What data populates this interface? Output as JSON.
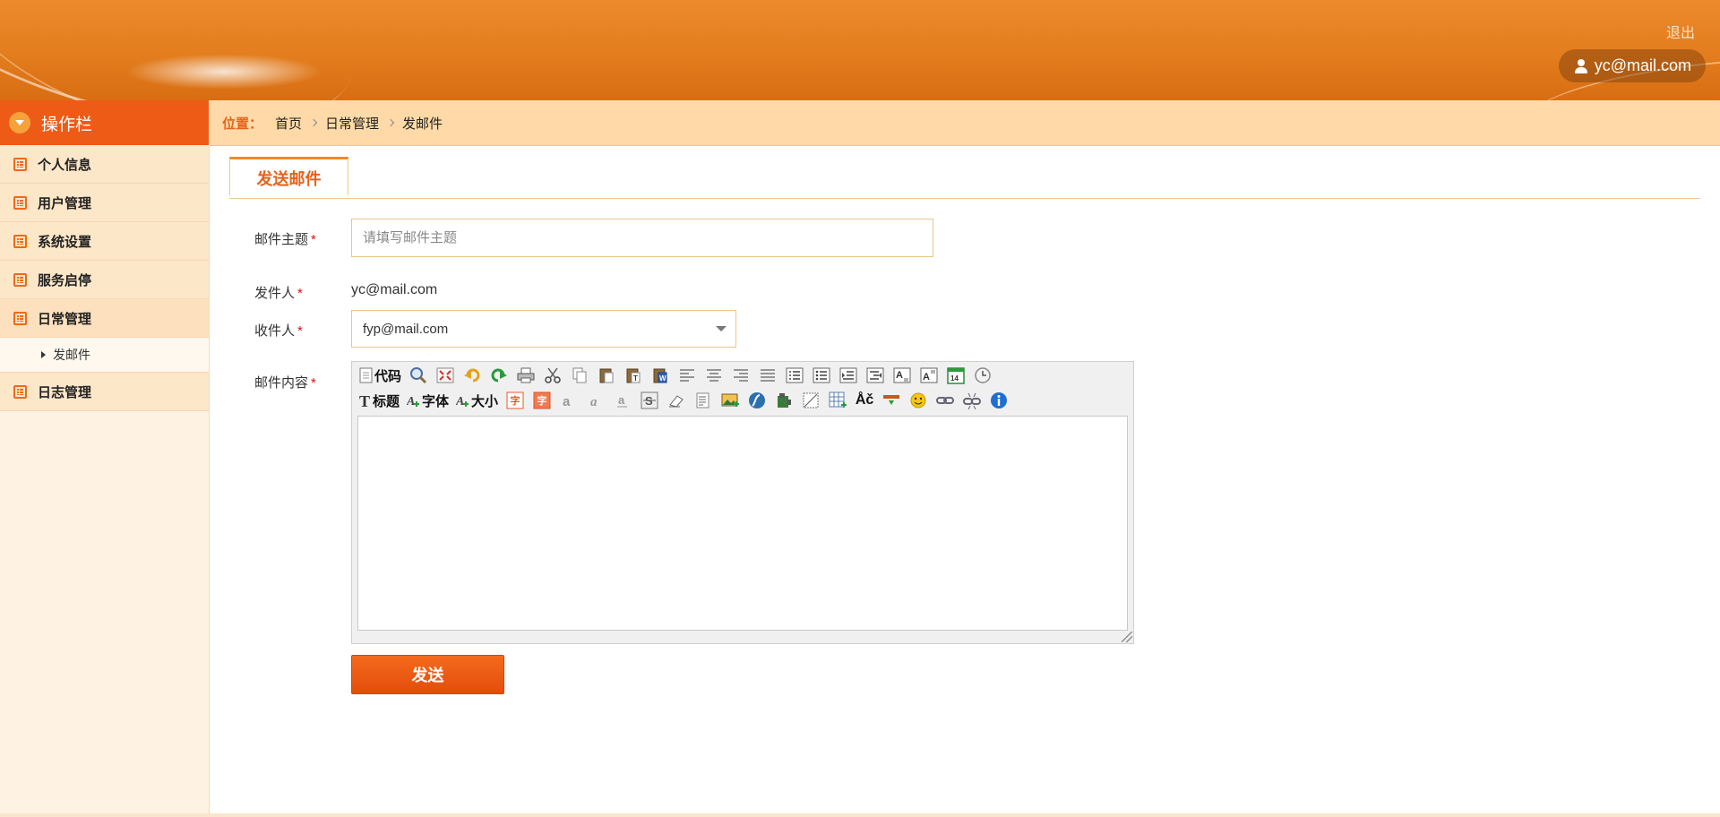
{
  "header": {
    "logout_label": "退出",
    "user_email": "yc@mail.com",
    "colors": {
      "primary": "#e37d1e",
      "accent": "#ee5b17"
    }
  },
  "sidebar": {
    "title": "操作栏",
    "items": [
      {
        "label": "个人信息",
        "icon": "list-icon"
      },
      {
        "label": "用户管理",
        "icon": "list-icon"
      },
      {
        "label": "系统设置",
        "icon": "list-icon"
      },
      {
        "label": "服务启停",
        "icon": "list-icon"
      },
      {
        "label": "日常管理",
        "icon": "list-icon",
        "expanded": true,
        "children": [
          {
            "label": "发邮件"
          }
        ]
      },
      {
        "label": "日志管理",
        "icon": "list-icon"
      }
    ]
  },
  "breadcrumb": {
    "prefix": "位置：",
    "items": [
      "首页",
      "日常管理",
      "发邮件"
    ]
  },
  "tabs": [
    {
      "label": "发送邮件",
      "active": true
    }
  ],
  "form": {
    "subject": {
      "label": "邮件主题",
      "placeholder": "请填写邮件主题",
      "value": ""
    },
    "sender": {
      "label": "发件人",
      "value": "yc@mail.com"
    },
    "recipient": {
      "label": "收件人",
      "value": "fyp@mail.com"
    },
    "content": {
      "label": "邮件内容"
    },
    "required_mark": "*",
    "send_label": "发送"
  },
  "editor": {
    "row1": [
      {
        "name": "source-code",
        "label": "代码"
      },
      {
        "name": "preview"
      },
      {
        "name": "fullscreen"
      },
      {
        "name": "undo"
      },
      {
        "name": "redo"
      },
      {
        "name": "print"
      },
      {
        "name": "cut"
      },
      {
        "name": "copy"
      },
      {
        "name": "paste"
      },
      {
        "name": "paste-text"
      },
      {
        "name": "paste-word"
      },
      {
        "name": "align-left"
      },
      {
        "name": "align-center"
      },
      {
        "name": "align-right"
      },
      {
        "name": "align-justify"
      },
      {
        "name": "ordered-list"
      },
      {
        "name": "unordered-list"
      },
      {
        "name": "indent"
      },
      {
        "name": "outdent"
      },
      {
        "name": "subscript"
      },
      {
        "name": "superscript"
      },
      {
        "name": "date"
      },
      {
        "name": "time"
      }
    ],
    "row2": [
      {
        "name": "heading",
        "label": "标题"
      },
      {
        "name": "font-family",
        "label": "字体"
      },
      {
        "name": "font-size",
        "label": "大小"
      },
      {
        "name": "font-color",
        "label": "字"
      },
      {
        "name": "background-color",
        "label": "字"
      },
      {
        "name": "bold"
      },
      {
        "name": "italic"
      },
      {
        "name": "underline"
      },
      {
        "name": "strikethrough"
      },
      {
        "name": "remove-format"
      },
      {
        "name": "select-all"
      },
      {
        "name": "image"
      },
      {
        "name": "flash"
      },
      {
        "name": "media"
      },
      {
        "name": "table-insert"
      },
      {
        "name": "table"
      },
      {
        "name": "special-char",
        "label": "Åč"
      },
      {
        "name": "horizontal-rule"
      },
      {
        "name": "emoticon"
      },
      {
        "name": "link"
      },
      {
        "name": "unlink"
      },
      {
        "name": "about"
      }
    ]
  }
}
